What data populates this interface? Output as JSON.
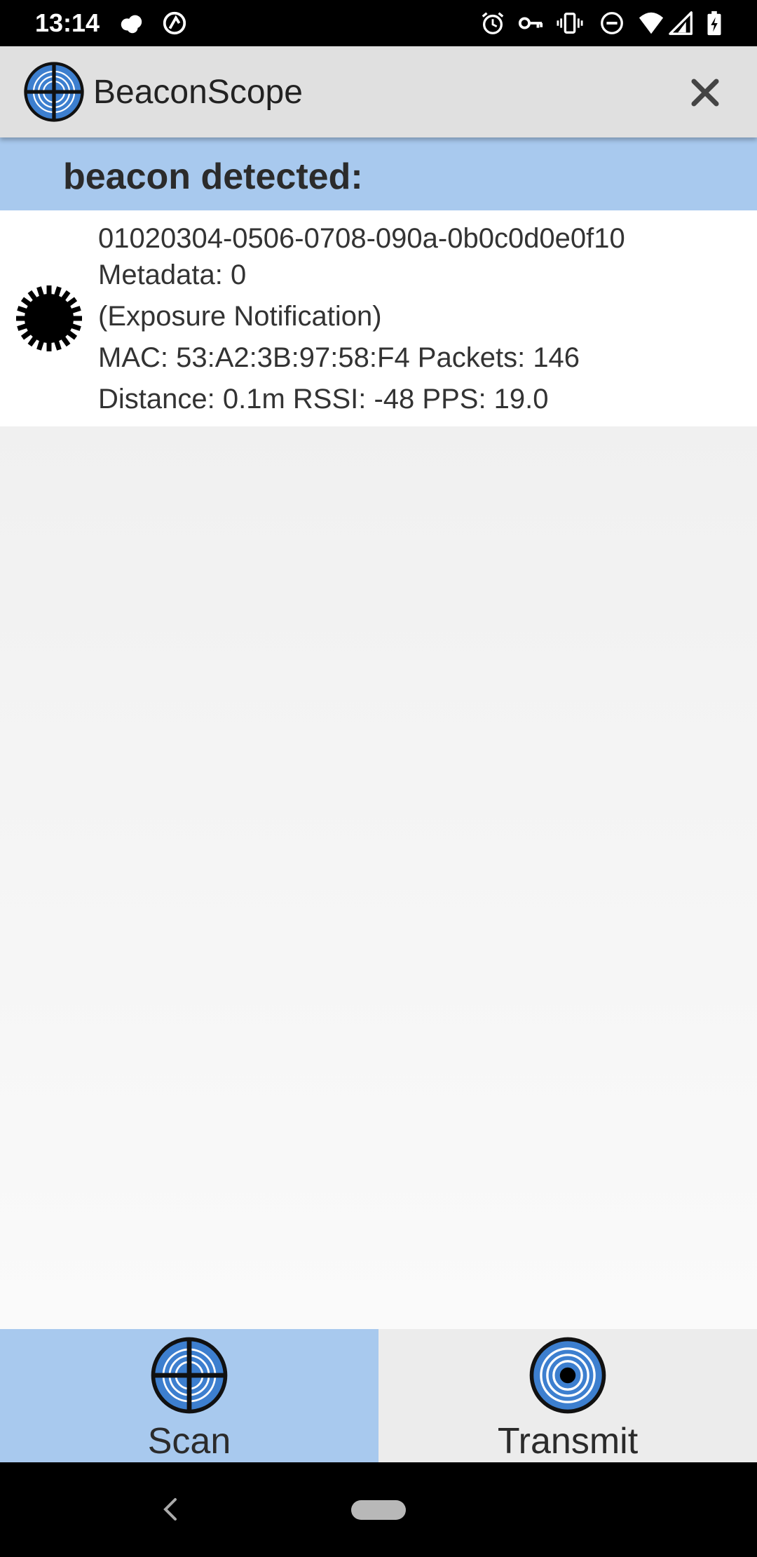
{
  "status_bar": {
    "time": "13:14",
    "left_icons": [
      "weather-icon",
      "sync-icon"
    ],
    "right_icons": [
      "alarm-icon",
      "vpn-key-icon",
      "vibrate-icon",
      "do-not-disturb-icon",
      "wifi-icon",
      "signal-icon",
      "battery-charging-icon"
    ]
  },
  "app_bar": {
    "title": "BeaconScope",
    "logo_icon": "crosshair-logo-icon",
    "close_icon": "close-icon"
  },
  "header": {
    "label": "beacon detected:"
  },
  "beacons": [
    {
      "icon": "coronavirus-icon",
      "id": "01020304-0506-0708-090a-0b0c0d0e0f10",
      "metadata": "Metadata: 0",
      "type": "(Exposure Notification)",
      "mac_packets": "MAC: 53:A2:3B:97:58:F4 Packets: 146",
      "distance_rssi_pps": "Distance: 0.1m RSSI: -48 PPS: 19.0"
    }
  ],
  "tabs": [
    {
      "label": "Scan",
      "icon": "scan-crosshair-icon",
      "selected": true
    },
    {
      "label": "Transmit",
      "icon": "transmit-target-icon",
      "selected": false
    }
  ],
  "colors": {
    "accent": "#a8c9ee",
    "app_bar": "#e0e0e0",
    "icon_blue": "#3d7fcf"
  }
}
